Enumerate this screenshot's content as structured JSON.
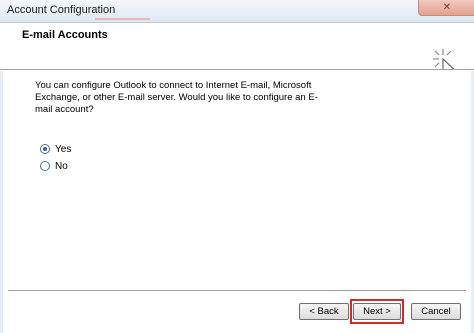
{
  "window": {
    "title": "Account Configuration",
    "close_glyph": "✕"
  },
  "header": {
    "title": "E-mail Accounts",
    "icon": "wizard-cursor-icon"
  },
  "main": {
    "description": "You can configure Outlook to connect to Internet E-mail, Microsoft Exchange, or other E-mail server. Would you like to configure an E-mail account?",
    "options": [
      {
        "label": "Yes",
        "selected": true
      },
      {
        "label": "No",
        "selected": false
      }
    ]
  },
  "footer": {
    "back_label": "< Back",
    "next_label": "Next >",
    "cancel_label": "Cancel"
  },
  "colors": {
    "highlight": "#d42a2a",
    "radio_accent": "#2a5fb0"
  }
}
